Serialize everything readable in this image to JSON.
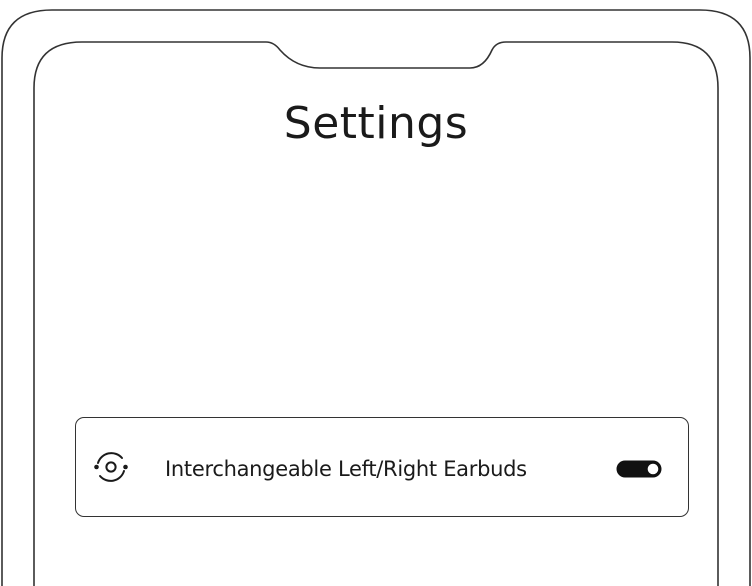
{
  "screen": {
    "title": "Settings"
  },
  "settings": {
    "items": [
      {
        "icon": "swap-earbuds-icon",
        "label": "Interchangeable Left/Right Earbuds",
        "enabled": true
      }
    ]
  },
  "colors": {
    "outline": "#333333",
    "text": "#1a1a1a",
    "toggle_on": "#111111",
    "background": "#ffffff"
  }
}
